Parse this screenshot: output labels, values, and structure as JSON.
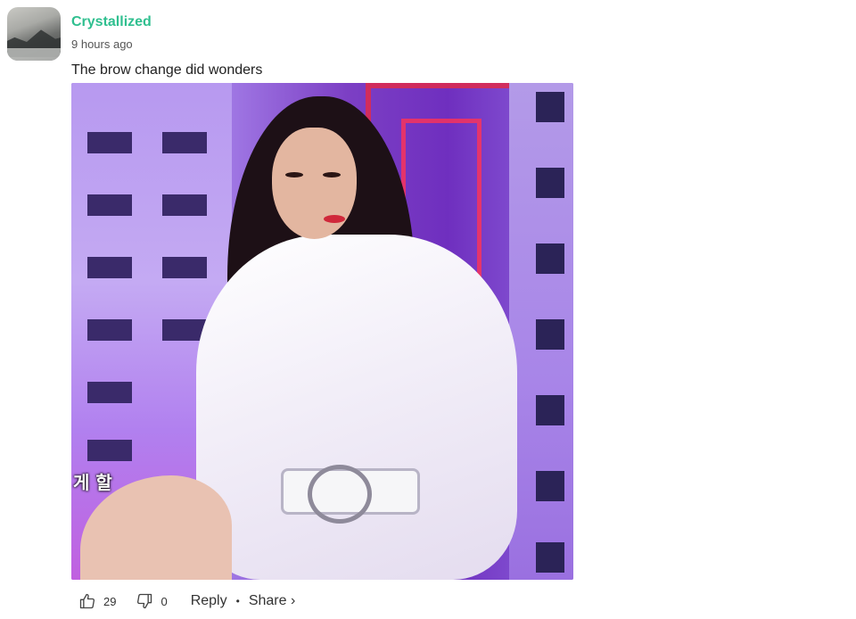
{
  "comment": {
    "username": "Crystallized",
    "timestamp": "9 hours ago",
    "text": "The brow change did wonders",
    "image_subtitle": "게 할",
    "likes": "29",
    "dislikes": "0",
    "reply_label": "Reply",
    "separator": "•",
    "share_label": "Share ›"
  },
  "colors": {
    "username": "#2fbf8f",
    "text": "#222222"
  },
  "icons": {
    "like": "thumbs-up-icon",
    "dislike": "thumbs-down-icon"
  }
}
